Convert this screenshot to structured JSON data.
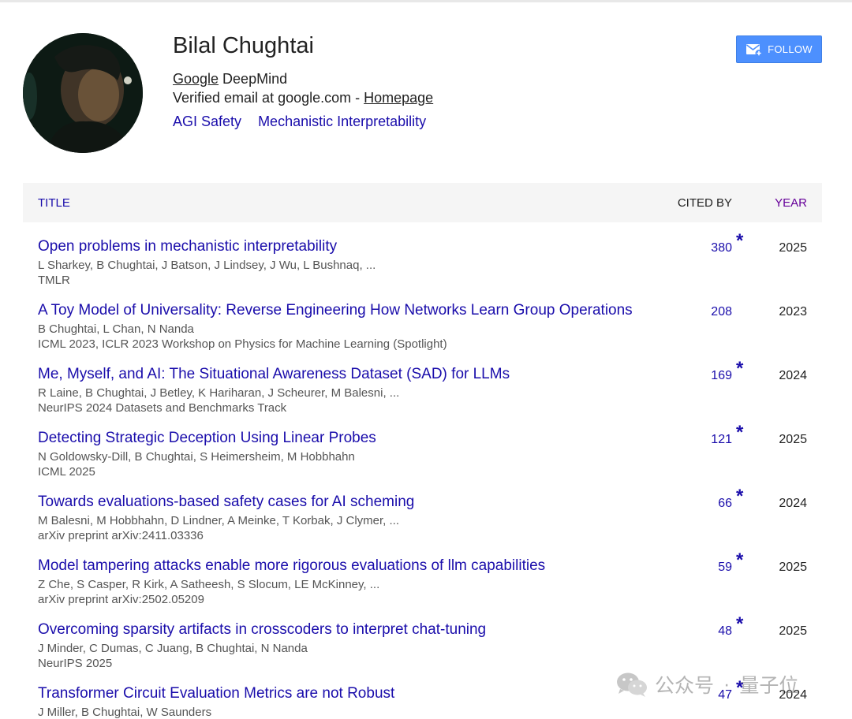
{
  "profile": {
    "name": "Bilal Chughtai",
    "affiliation_link": "Google",
    "affiliation_rest": " DeepMind",
    "email_text": "Verified email at google.com - ",
    "homepage_label": "Homepage",
    "interests": [
      "AGI Safety",
      "Mechanistic Interpretability"
    ],
    "follow_label": "FOLLOW"
  },
  "table": {
    "headers": {
      "title": "TITLE",
      "cited_by": "CITED BY",
      "year": "YEAR"
    },
    "rows": [
      {
        "title": "Open problems in mechanistic interpretability",
        "authors": "L Sharkey, B Chughtai, J Batson, J Lindsey, J Wu, L Bushnaq, ...",
        "venue": "TMLR",
        "cited_by": "380",
        "star": "*",
        "year": "2025"
      },
      {
        "title": "A Toy Model of Universality: Reverse Engineering How Networks Learn Group Operations",
        "authors": "B Chughtai, L Chan, N Nanda",
        "venue": "ICML 2023, ICLR 2023 Workshop on Physics for Machine Learning (Spotlight)",
        "cited_by": "208",
        "star": "",
        "year": "2023"
      },
      {
        "title": "Me, Myself, and AI: The Situational Awareness Dataset (SAD) for LLMs",
        "authors": "R Laine, B Chughtai, J Betley, K Hariharan, J Scheurer, M Balesni, ...",
        "venue": "NeurIPS 2024 Datasets and Benchmarks Track",
        "cited_by": "169",
        "star": "*",
        "year": "2024"
      },
      {
        "title": "Detecting Strategic Deception Using Linear Probes",
        "authors": "N Goldowsky-Dill, B Chughtai, S Heimersheim, M Hobbhahn",
        "venue": "ICML 2025",
        "cited_by": "121",
        "star": "*",
        "year": "2025"
      },
      {
        "title": "Towards evaluations-based safety cases for AI scheming",
        "authors": "M Balesni, M Hobbhahn, D Lindner, A Meinke, T Korbak, J Clymer, ...",
        "venue": "arXiv preprint arXiv:2411.03336",
        "cited_by": "66",
        "star": "*",
        "year": "2024"
      },
      {
        "title": "Model tampering attacks enable more rigorous evaluations of llm capabilities",
        "authors": "Z Che, S Casper, R Kirk, A Satheesh, S Slocum, LE McKinney, ...",
        "venue": "arXiv preprint arXiv:2502.05209",
        "cited_by": "59",
        "star": "*",
        "year": "2025"
      },
      {
        "title": "Overcoming sparsity artifacts in crosscoders to interpret chat-tuning",
        "authors": "J Minder, C Dumas, C Juang, B Chughtai, N Nanda",
        "venue": "NeurIPS 2025",
        "cited_by": "48",
        "star": "*",
        "year": "2025"
      },
      {
        "title": "Transformer Circuit Evaluation Metrics are not Robust",
        "authors": "J Miller, B Chughtai, W Saunders",
        "venue": "",
        "cited_by": "47",
        "star": "*",
        "year": "2024"
      }
    ]
  },
  "watermark": {
    "left_text": "公众号",
    "separator": "·",
    "right_text": "量子位"
  },
  "colors": {
    "link": "#1a0dab",
    "year_header": "#660099",
    "follow_button": "#4d90fe",
    "header_band": "#f5f5f5"
  },
  "icons": {
    "follow": "envelope-plus-icon",
    "watermark": "wechat-icon"
  }
}
